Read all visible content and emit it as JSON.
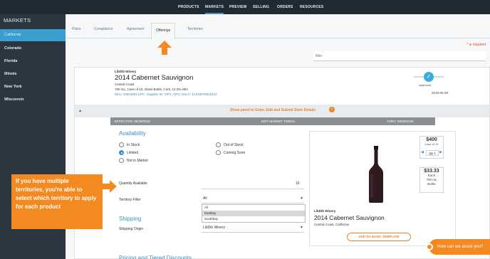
{
  "topnav": {
    "items": [
      "PRODUCTS",
      "MARKETS",
      "PREVIEW",
      "SELLING",
      "ORDERS",
      "RESOURCES"
    ],
    "active": "MARKETS"
  },
  "sidebar": {
    "title": "MARKETS",
    "items": [
      "California",
      "Colorado",
      "Florida",
      "Illinois",
      "New York",
      "Wisconsin"
    ],
    "active": "California"
  },
  "tabs": {
    "items": [
      "Plans",
      "Compliance",
      "Agreement",
      "Offerings",
      "Territories"
    ],
    "active": "Offerings"
  },
  "required_note": "* is required",
  "filter": {
    "placeholder": "filter"
  },
  "product": {
    "winery": "LibDib Winery",
    "name": "2014 Cabernet Sauvignon",
    "region": "Central Coast",
    "description": "750 mL, Case of 12, Glass Bottle, Cork, 13.2% ABV",
    "ids": "SKU: 10004684   UPC:   Supplier ID:   VIP1:   VIP2:   EDLA: 12345678910123",
    "status": "Approved",
    "date": "2018-05-28"
  },
  "panel": {
    "message": "Show panel to Enter, Edit and Submit State Details",
    "info_icon": "info-icon"
  },
  "effective_bar": {
    "effective": "EFFECTIVE: 05/28/2018",
    "edit": "EDIT MARKET TIMING",
    "thru": "THRU: 03/20/2120"
  },
  "availability": {
    "title": "Availability",
    "options": [
      "In Stock",
      "Out of Stock",
      "Limited",
      "Coming Soon",
      "Not in Market"
    ],
    "selected": "Limited",
    "quantity_label": "Quantity Available",
    "quantity_value": "16"
  },
  "territory": {
    "label": "Territory Filter",
    "value": "All",
    "options": [
      "All",
      "Eastbay",
      "Southbay"
    ],
    "highlighted": "Eastbay"
  },
  "shipping": {
    "title": "Shipping",
    "origin_label": "Shipping Origin",
    "origin_value": "LibDib Winery"
  },
  "pricing_title": "Pricing and Tiered Discounts",
  "preview": {
    "case_price": "$400",
    "case_label": "Case of 12",
    "qty_label": "qty 1",
    "each_price": "$33.33",
    "each_label": "Each",
    "size": "750 mL",
    "unit": "Bottle",
    "winery": "LibDib Winery",
    "name": "2014 Cabernet Sauvignon",
    "region": "Central Coast, California",
    "add_button": "ADD TO BASIC TEMPLATE"
  },
  "annotation": "If you have multiple territories, you're able to select which territory to apply for each product",
  "chat": {
    "label": "How can we assist you?"
  },
  "colors": {
    "accent": "#3a9fcf",
    "orange": "#f28a21",
    "nav": "#1f2a33",
    "sidebar": "#2b3640"
  }
}
